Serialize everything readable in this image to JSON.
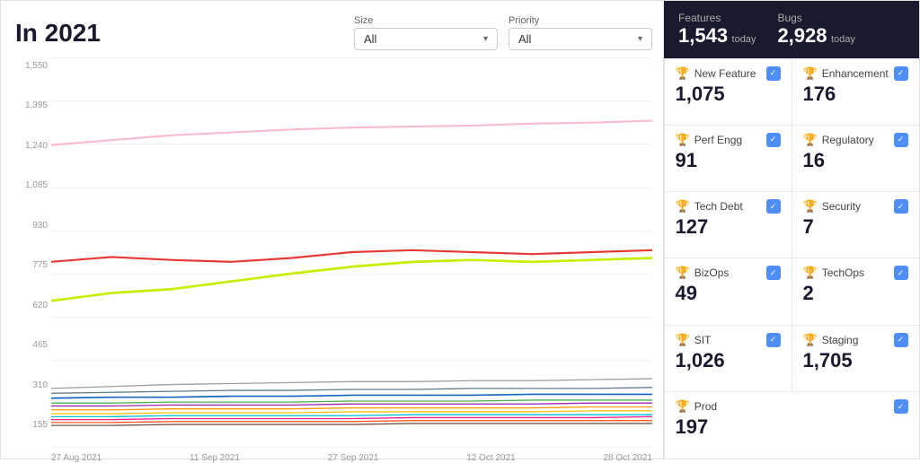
{
  "title": "In 2021",
  "filters": {
    "size_label": "Size",
    "size_value": "All",
    "priority_label": "Priority",
    "priority_value": "All"
  },
  "summary": {
    "features_label": "Features",
    "features_value": "1,543",
    "features_sub": "today",
    "bugs_label": "Bugs",
    "bugs_value": "2,928",
    "bugs_sub": "today"
  },
  "y_axis": [
    "1,550",
    "1,395",
    "1,240",
    "1,085",
    "930",
    "775",
    "620",
    "465",
    "310",
    "155"
  ],
  "x_axis": [
    "27 Aug 2021",
    "11 Sep 2021",
    "27 Sep 2021",
    "12 Oct 2021",
    "28 Oct 2021"
  ],
  "metrics": [
    {
      "icon": "🏆",
      "icon_color": "#e91e8c",
      "name": "New Feature",
      "value": "1,075",
      "checked": true
    },
    {
      "icon": "🏆",
      "icon_color": "#4caf50",
      "name": "Enhancement",
      "value": "176",
      "checked": true
    },
    {
      "icon": "🏆",
      "icon_color": "#ff9800",
      "name": "Perf Engg",
      "value": "91",
      "checked": true
    },
    {
      "icon": "🏆",
      "icon_color": "#9c27b0",
      "name": "Regulatory",
      "value": "16",
      "checked": true
    },
    {
      "icon": "🏆",
      "icon_color": "#607d8b",
      "name": "Tech Debt",
      "value": "127",
      "checked": true
    },
    {
      "icon": "🏆",
      "icon_color": "#00bcd4",
      "name": "Security",
      "value": "7",
      "checked": true
    },
    {
      "icon": "🏆",
      "icon_color": "#ffc107",
      "name": "BizOps",
      "value": "49",
      "checked": true
    },
    {
      "icon": "🏆",
      "icon_color": "#ff5722",
      "name": "TechOps",
      "value": "2",
      "checked": true
    },
    {
      "icon": "🐛",
      "icon_color": "#f44336",
      "name": "SIT",
      "value": "1,026",
      "checked": true
    },
    {
      "icon": "🐛",
      "icon_color": "#e91e8c",
      "name": "Staging",
      "value": "1,705",
      "checked": true
    },
    {
      "icon": "🐛",
      "icon_color": "#f44336",
      "name": "Prod",
      "value": "197",
      "checked": true,
      "full": true
    }
  ]
}
